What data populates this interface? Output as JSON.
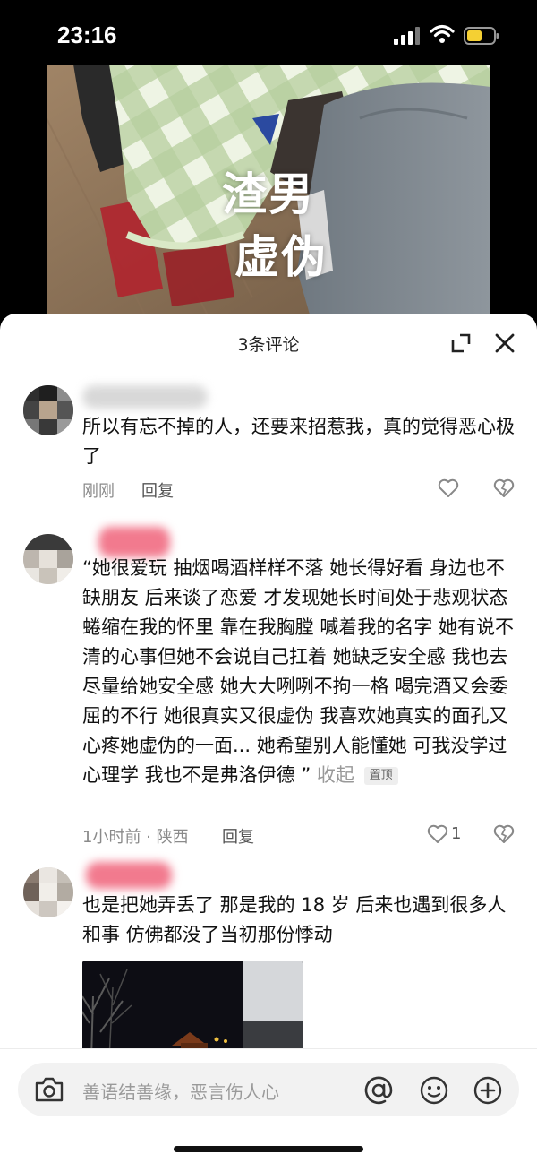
{
  "status_bar": {
    "time": "23:16"
  },
  "video": {
    "overlay_line1": "渣男",
    "overlay_line2": "虚伪"
  },
  "sheet": {
    "title": "3条评论"
  },
  "comments": [
    {
      "text": "所以有忘不掉的人，还要来招惹我，真的觉得恶心极了",
      "time": "刚刚",
      "reply_label": "回复"
    },
    {
      "text": "“她很爱玩 抽烟喝酒样样不落 她长得好看 身边也不缺朋友 后来谈了恋爱 才发现她长时间处于悲观状态 蜷缩在我的怀里 靠在我胸膛 喊着我的名字 她有说不清的心事但她不会说自己扛着 她缺乏安全感 我也去尽量给她安全感 她大大咧咧不拘一格 喝完酒又会委屈的不行 她很真实又很虚伪 我喜欢她真实的面孔又心疼她虚伪的一面... 她希望别人能懂她 可我没学过心理学 我也不是弗洛伊德 ”",
      "collapse_label": "收起",
      "pin_label": "置顶",
      "time": "1小时前 · 陕西",
      "reply_label": "回复",
      "like_count": "1"
    },
    {
      "text": "也是把她弄丢了 那是我的 18 岁 后来也遇到很多人和事 仿佛都没了当初那份悸动"
    }
  ],
  "input": {
    "placeholder": "善语结善缘，恶言伤人心"
  }
}
